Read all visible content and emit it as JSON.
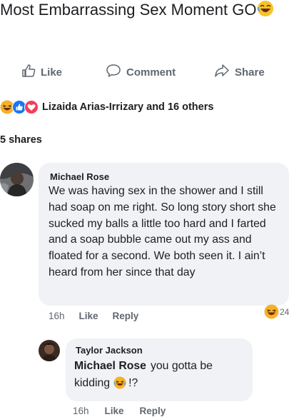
{
  "post": {
    "title": "Most Embarrassing Sex Moment GO",
    "title_emoji": "laughing-face"
  },
  "actions": {
    "like": "Like",
    "comment": "Comment",
    "share": "Share"
  },
  "reactions": {
    "icons": [
      "haha-reaction",
      "like-reaction",
      "love-reaction"
    ],
    "text": "Lizaida Arias-Irrizary and 16 others"
  },
  "shares": "5 shares",
  "comments": [
    {
      "author": "Michael Rose",
      "text": "We was having sex in the shower and I still had soap on me right. So long story short she sucked my balls a little too hard and I farted and a soap bubble came out my ass and floated for a second. We both seen it. I ain’t heard from her since that day",
      "time": "16h",
      "like": "Like",
      "reply": "Reply",
      "reaction_count": "24",
      "reaction_icon": "haha-reaction"
    },
    {
      "author": "Taylor Jackson",
      "mention": "Michael Rose",
      "text_before_emoji": "you gotta be kidding",
      "text_after_emoji": "!?",
      "emoji": "laughing-face",
      "time": "16h",
      "like": "Like",
      "reply": "Reply"
    }
  ],
  "colors": {
    "bubble": "#f0f2f5",
    "meta_text": "#606770",
    "text": "#1c1e21",
    "like_blue": "#1877f2",
    "love_red": "#f33e58",
    "haha_yellow": "#f7b125"
  }
}
